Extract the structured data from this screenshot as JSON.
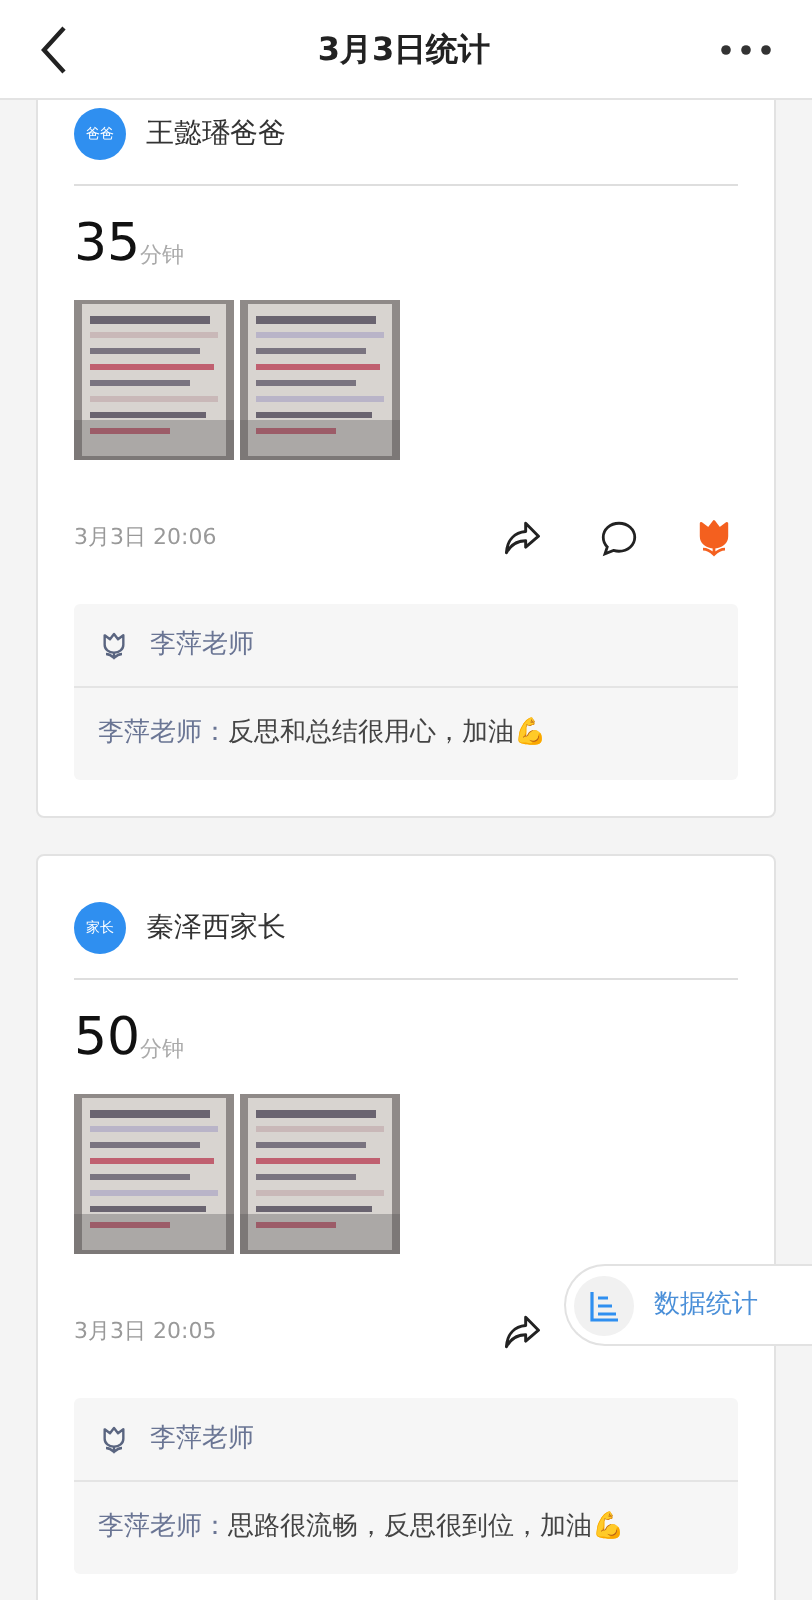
{
  "header": {
    "title": "3月3日统计"
  },
  "posts": [
    {
      "avatar": "爸爸",
      "name": "王懿璠爸爸",
      "minutes": "35",
      "unit": "分钟",
      "photos": [
        {
          "kind": "picture"
        },
        {
          "kind": "picture"
        }
      ],
      "time": "3月3日 20:06",
      "actions": [
        {
          "kind": "share"
        },
        {
          "kind": "comment"
        },
        {
          "kind": "like",
          "selected": true
        }
      ],
      "likes": {
        "names": "李萍老师"
      },
      "comments": [
        {
          "author": "李萍老师：",
          "text": "反思和总结很用心，加油💪"
        }
      ]
    },
    {
      "avatar": "家长",
      "name": "秦泽西家长",
      "minutes": "50",
      "unit": "分钟",
      "photos": [
        {
          "kind": "picture"
        },
        {
          "kind": "picture"
        }
      ],
      "time": "3月3日 20:05",
      "actions": [
        {
          "kind": "share"
        }
      ],
      "likes": {
        "names": "李萍老师"
      },
      "comments": [
        {
          "author": "李萍老师：",
          "text": "思路很流畅，反思很到位，加油💪"
        }
      ]
    }
  ],
  "floating_button": {
    "label": "数据统计"
  }
}
